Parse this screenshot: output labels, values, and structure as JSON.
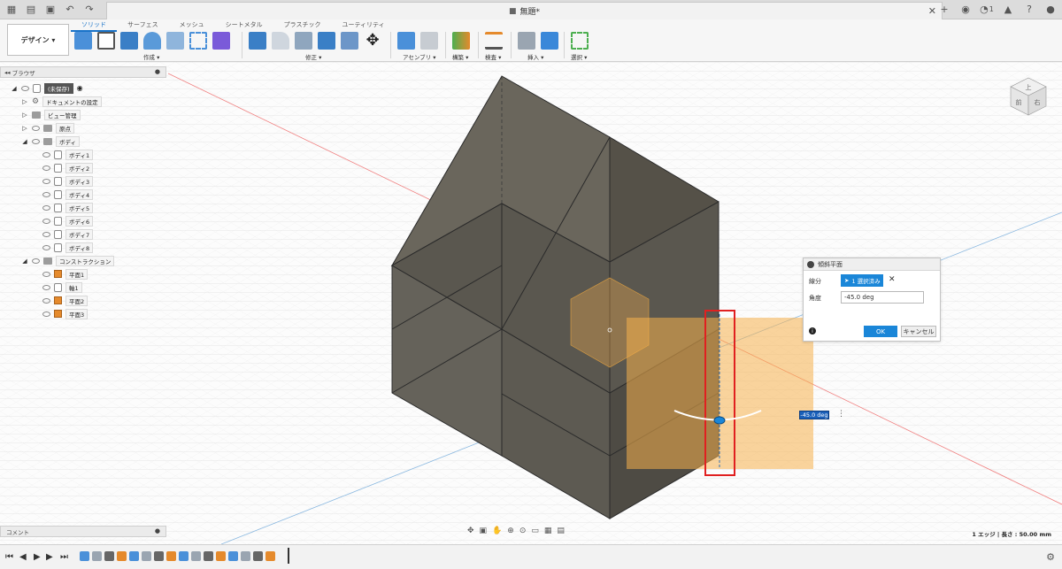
{
  "titlebar": {
    "doc_title": "無題*",
    "notification_count": "1"
  },
  "ribbon": {
    "workspace": "デザイン ▾",
    "tabs": [
      "ソリッド",
      "サーフェス",
      "メッシュ",
      "シートメタル",
      "プラスチック",
      "ユーティリティ"
    ],
    "groups": [
      "作成 ▾",
      "修正 ▾",
      "アセンブリ ▾",
      "構築 ▾",
      "検査 ▾",
      "挿入 ▾",
      "選択 ▾"
    ]
  },
  "browser": {
    "title": "ブラウザ",
    "items": [
      {
        "label": "(未保存)",
        "kind": "root"
      },
      {
        "label": "ドキュメントの設定",
        "kind": "settings"
      },
      {
        "label": "ビュー管理",
        "kind": "folder"
      },
      {
        "label": "原点",
        "kind": "folder"
      },
      {
        "label": "ボディ",
        "kind": "folder"
      },
      {
        "label": "ボディ1",
        "kind": "body"
      },
      {
        "label": "ボディ2",
        "kind": "body"
      },
      {
        "label": "ボディ3",
        "kind": "body"
      },
      {
        "label": "ボディ4",
        "kind": "body"
      },
      {
        "label": "ボディ5",
        "kind": "body"
      },
      {
        "label": "ボディ6",
        "kind": "body"
      },
      {
        "label": "ボディ7",
        "kind": "body"
      },
      {
        "label": "ボディ8",
        "kind": "body"
      },
      {
        "label": "コンストラクション",
        "kind": "folder"
      },
      {
        "label": "平面1",
        "kind": "plane"
      },
      {
        "label": "軸1",
        "kind": "axis"
      },
      {
        "label": "平面2",
        "kind": "plane"
      },
      {
        "label": "平面3",
        "kind": "plane"
      }
    ]
  },
  "comment": {
    "title": "コメント"
  },
  "dialog": {
    "title": "傾斜平面",
    "edge_label": "線分",
    "edge_value": "1 選択済み",
    "angle_label": "角度",
    "angle_value": "-45.0 deg",
    "ok": "OK",
    "cancel": "キャンセル"
  },
  "viewcube": {
    "top": "上",
    "front": "前",
    "right": "右"
  },
  "angle_float": "-45.0 deg",
  "status": "1 エッジ | 長さ : 50.00 mm",
  "colors": {
    "accent": "#1a86d8",
    "solid_dark": "#5d5a52",
    "plane_orange": "#f5b04c",
    "highlight_red": "#e02020"
  }
}
